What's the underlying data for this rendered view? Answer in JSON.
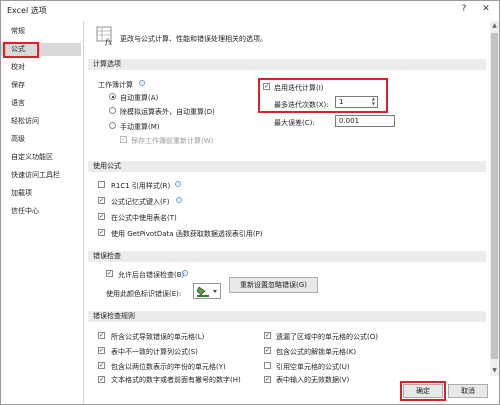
{
  "window": {
    "title": "Excel 选项",
    "help": "?",
    "close": "✕"
  },
  "sidebar": {
    "items": [
      "常规",
      "公式",
      "校对",
      "保存",
      "语言",
      "轻松访问",
      "高级",
      "自定义功能区",
      "快速访问工具栏",
      "加载项",
      "信任中心"
    ]
  },
  "header": {
    "text": "更改与公式计算、性能和错误处理相关的选项。"
  },
  "calc": {
    "section": "计算选项",
    "workbook_label": "工作簿计算",
    "auto": "自动重算(A)",
    "auto_except": "除模拟运算表外，自动重算(D)",
    "manual": "手动重算(M)",
    "recalc_before_save": "保存工作簿前重新计算(W)",
    "iterative": "启用迭代计算(I)",
    "max_iter_label": "最多迭代次数(X):",
    "max_iter_value": "1",
    "max_change_label": "最大误差(C):",
    "max_change_value": "0.001"
  },
  "formulas": {
    "section": "使用公式",
    "items": [
      "R1C1 引用样式(R)",
      "公式记忆式键入(F)",
      "在公式中使用表名(T)",
      "使用 GetPivotData 函数获取数据透视表引用(P)"
    ],
    "checked": [
      false,
      true,
      true,
      true
    ]
  },
  "error_check": {
    "section": "错误检查",
    "background": "允许后台错误检查(B)",
    "color_label": "使用此颜色标识错误(E):",
    "reset_button": "重新设置忽略错误(G)"
  },
  "rules": {
    "section": "错误检查规则",
    "left": [
      "所含公式导致错误的单元格(L)",
      "表中不一致的计算列公式(S)",
      "包含以两位数表示的年份的单元格(Y)",
      "文本格式的数字或者前面有撇号的数字(H)"
    ],
    "right": [
      "遗漏了区域中的单元格的公式(O)",
      "包含公式的解锁单元格(K)",
      "引用空单元格的公式(U)",
      "表中输入的无效数据(V)"
    ],
    "left_checked": [
      true,
      true,
      true,
      true
    ],
    "right_checked": [
      true,
      true,
      false,
      true
    ]
  },
  "footer": {
    "ok": "确定",
    "cancel": "取消"
  },
  "colors": {
    "highlight": "#d8222a",
    "selected_bg": "#d9d9d9",
    "section_bg": "#ececec"
  }
}
